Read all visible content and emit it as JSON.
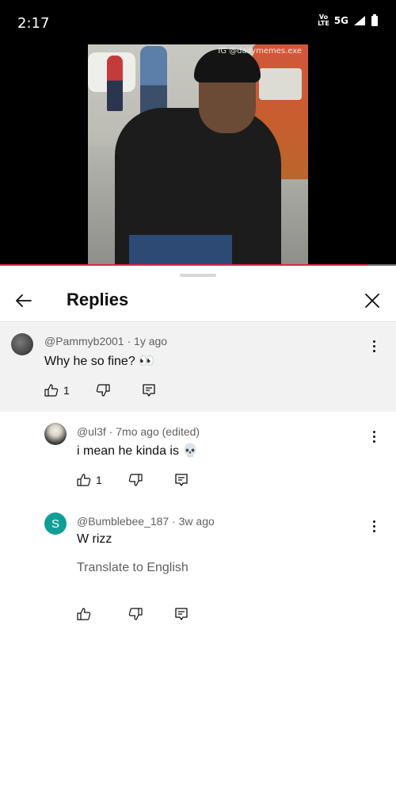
{
  "status_bar": {
    "time": "2:17",
    "volte_top": "Vo",
    "volte_bottom": "LTE",
    "network": "5G"
  },
  "video": {
    "watermark": "IG @dailymemes.exe",
    "progress": 0.93
  },
  "sheet": {
    "title": "Replies"
  },
  "parent_comment": {
    "author": "@Pammyb2001",
    "age": "1y ago",
    "text": "Why he so fine? 👀",
    "likes": "1"
  },
  "replies": [
    {
      "author": "@ul3f",
      "age": "7mo ago (edited)",
      "text": "i mean he kinda is 💀",
      "likes": "1"
    },
    {
      "author": "@Bumblebee_187",
      "age": "3w ago",
      "text": "W rizz",
      "avatar_letter": "S",
      "avatar_color": "#129e97",
      "translate_label": "Translate to English",
      "likes": ""
    }
  ],
  "colors": {
    "progress": "#e0244e",
    "parent_bg": "#f2f2f2"
  }
}
